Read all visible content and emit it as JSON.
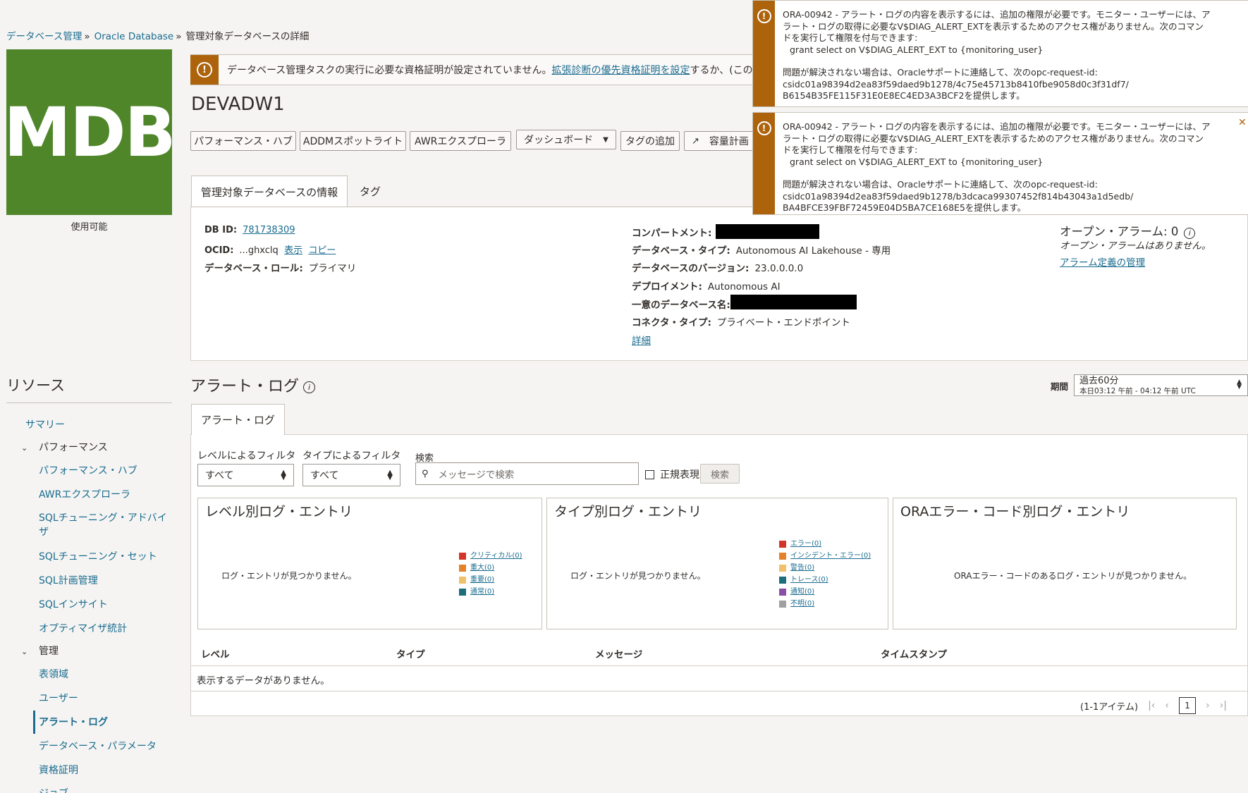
{
  "breadcrumb": {
    "items": [
      "データベース管理",
      "Oracle Database"
    ],
    "current": "管理対象データベースの詳細"
  },
  "logo": {
    "text": "MDB",
    "status": "使用可能",
    "color": "#4f862a"
  },
  "credential_warning": {
    "text_before": "データベース管理タスクの実行に必要な資格証明が設定されていません。",
    "link": "拡張診断の優先資格証明を設定",
    "text_after": "するか、(このセッショ"
  },
  "page_title": "DEVADW1",
  "toolbar": {
    "performance_hub": "パフォーマンス・ハブ",
    "addm_spotlight": "ADDMスポットライト",
    "awr_explorer": "AWRエクスプローラ",
    "dashboard": "ダッシュボード",
    "add_tags": "タグの追加",
    "capacity_planning": "容量計画"
  },
  "tabs": {
    "info": "管理対象データベースの情報",
    "tags": "タグ"
  },
  "info": {
    "db_id_label": "DB ID:",
    "db_id": "781738309",
    "ocid_label": "OCID:",
    "ocid": "...ghxclq",
    "ocid_show": "表示",
    "ocid_copy": "コピー",
    "role_label": "データベース・ロール:",
    "role": "プライマリ",
    "compartment_label": "コンパートメント:",
    "db_type_label": "データベース・タイプ:",
    "db_type": "Autonomous AI Lakehouse - 専用",
    "version_label": "データベースのバージョン:",
    "version": "23.0.0.0.0",
    "deployment_label": "デプロイメント:",
    "deployment": "Autonomous AI",
    "unique_name_label": "一意のデータベース名:",
    "connector_label": "コネクタ・タイプ:",
    "connector": "プライベート・エンドポイント",
    "details_link": "詳細",
    "alarms_title": "オープン・アラーム: 0",
    "alarms_none": "オープン・アラームはありません。",
    "alarms_manage": "アラーム定義の管理"
  },
  "notifications": [
    {
      "line1": "ORA-00942 - アラート・ログの内容を表示するには、追加の権限が必要です。モニター・ユーザーには、ア",
      "line2": "ラート・ログの取得に必要なV$DIAG_ALERT_EXTを表示するためのアクセス権がありません。次のコマン",
      "line3": "ドを実行して権限を付与できます:",
      "line4": "grant select on V$DIAG_ALERT_EXT to {monitoring_user}",
      "line5": "問題が解決されない場合は、Oracleサポートに連絡して、次のopc-request-id:",
      "line6": "csidc01a98394d2ea83f59daed9b1278/4c75e45713b8410fbe9058d0c3f31df7/",
      "line7": "B6154B35FE115F31E0E8EC4ED3A3BCF2を提供します。"
    },
    {
      "line1": "ORA-00942 - アラート・ログの内容を表示するには、追加の権限が必要です。モニター・ユーザーには、ア",
      "line2": "ラート・ログの取得に必要なV$DIAG_ALERT_EXTを表示するためのアクセス権がありません。次のコマン",
      "line3": "ドを実行して権限を付与できます:",
      "line4": "grant select on V$DIAG_ALERT_EXT to {monitoring_user}",
      "line5": "問題が解決されない場合は、Oracleサポートに連絡して、次のopc-request-id:",
      "line6": "csidc01a98394d2ea83f59daed9b1278/b3dcaca99307452f814b43043a1d5edb/",
      "line7": "BA4BFCE39FBF72459E04D5BA7CE168E5を提供します。"
    }
  ],
  "sidebar": {
    "title": "リソース",
    "summary": "サマリー",
    "performance": "パフォーマンス",
    "performance_hub": "パフォーマンス・ハブ",
    "awr_explorer": "AWRエクスプローラ",
    "sql_tuning_advisor_1": "SQLチューニング・アドバイ",
    "sql_tuning_advisor_2": "ザ",
    "sql_tuning_set": "SQLチューニング・セット",
    "sql_plan_mgmt": "SQL計画管理",
    "sql_insight": "SQLインサイト",
    "optimizer_stats": "オプティマイザ統計",
    "admin": "管理",
    "tablespaces": "表領域",
    "users": "ユーザー",
    "alert_log": "アラート・ログ",
    "db_params": "データベース・パラメータ",
    "credentials": "資格証明",
    "more": "ジョブ"
  },
  "alert_log": {
    "title": "アラート・ログ",
    "period_label": "期間",
    "period_value": "過去60分",
    "period_range": "本日03:12 午前 - 04:12 午前 UTC",
    "tab": "アラート・ログ",
    "level_filter_label": "レベルによるフィルタ",
    "level_filter_value": "すべて",
    "type_filter_label": "タイプによるフィルタ",
    "type_filter_value": "すべて",
    "search_label": "検索",
    "search_placeholder": "メッセージで検索",
    "regex_label": "正規表現",
    "search_button": "検索"
  },
  "cards": {
    "by_level": {
      "title": "レベル別ログ・エントリ",
      "empty": "ログ・エントリが見つかりません。",
      "legend": [
        {
          "label": "クリティカル(0)",
          "color": "#d13628"
        },
        {
          "label": "重大(0)",
          "color": "#e3822b"
        },
        {
          "label": "重要(0)",
          "color": "#f0c16a"
        },
        {
          "label": "通常(0)",
          "color": "#1d6e7c"
        }
      ]
    },
    "by_type": {
      "title": "タイプ別ログ・エントリ",
      "empty": "ログ・エントリが見つかりません。",
      "legend": [
        {
          "label": "エラー(0)",
          "color": "#d13628"
        },
        {
          "label": "インシデント・エラー(0)",
          "color": "#e3822b"
        },
        {
          "label": "警告(0)",
          "color": "#f0c16a"
        },
        {
          "label": "トレース(0)",
          "color": "#1d6e7c"
        },
        {
          "label": "通知(0)",
          "color": "#8b4ea6"
        },
        {
          "label": "不明(0)",
          "color": "#a0a0a0"
        }
      ]
    },
    "by_ora": {
      "title": "ORAエラー・コード別ログ・エントリ",
      "empty": "ORAエラー・コードのあるログ・エントリが見つかりません。"
    }
  },
  "table": {
    "columns": [
      "レベル",
      "タイプ",
      "メッセージ",
      "タイムスタンプ"
    ],
    "empty": "表示するデータがありません。",
    "items": "(1-1アイテム)",
    "page": "1"
  }
}
